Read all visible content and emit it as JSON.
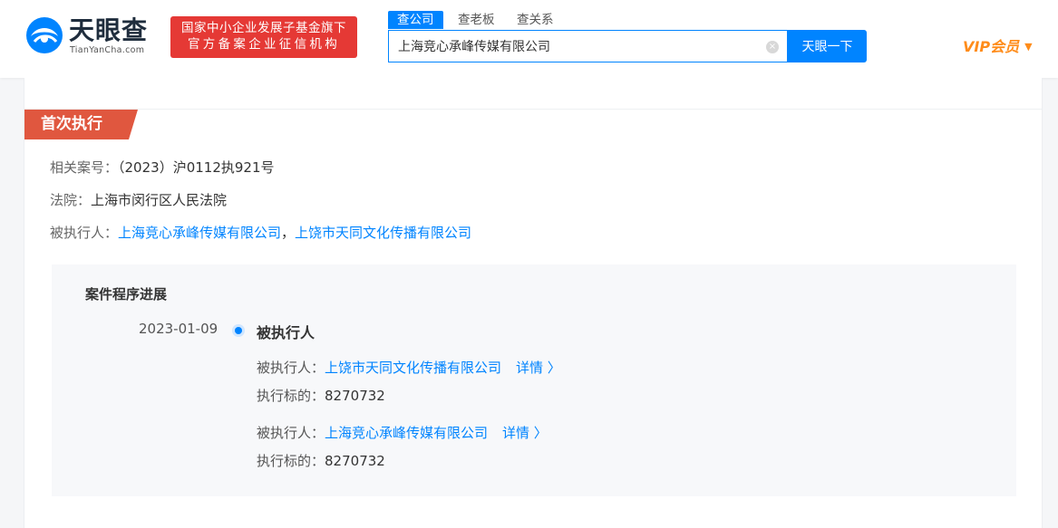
{
  "header": {
    "logo_text": "天眼查",
    "logo_sub": "TianYanCha.com",
    "badge_line1": "国家中小企业发展子基金旗下",
    "badge_line2": "官方备案企业征信机构",
    "tabs": [
      "查公司",
      "查老板",
      "查关系"
    ],
    "search_value": "上海竞心承峰传媒有限公司",
    "search_button": "天眼一下",
    "vip_label": "VIP会员",
    "clear_symbol": "×",
    "caret_symbol": "▼"
  },
  "section": {
    "title": "首次执行",
    "case_label": "相关案号：",
    "case_value": "（2023）沪0112执921号",
    "court_label": "法院：",
    "court_value": "上海市闵行区人民法院",
    "executed_label": "被执行人：",
    "executed_1": "上海竞心承峰传媒有限公司",
    "separator": "，",
    "executed_2": "上饶市天同文化传播有限公司"
  },
  "progress": {
    "title": "案件程序进展",
    "date": "2023-01-09",
    "event": "被执行人",
    "entries": [
      {
        "label": "被执行人：",
        "company": "上饶市天同文化传播有限公司",
        "detail": "详情 〉",
        "subject_label": "执行标的：",
        "subject_value": "8270732"
      },
      {
        "label": "被执行人：",
        "company": "上海竞心承峰传媒有限公司",
        "detail": "详情 〉",
        "subject_label": "执行标的：",
        "subject_value": "8270732"
      }
    ]
  },
  "colors": {
    "brand_blue": "#0084ff",
    "badge_red": "#e53935",
    "section_tag": "#e0573f",
    "vip_orange": "#ff8c1a"
  }
}
